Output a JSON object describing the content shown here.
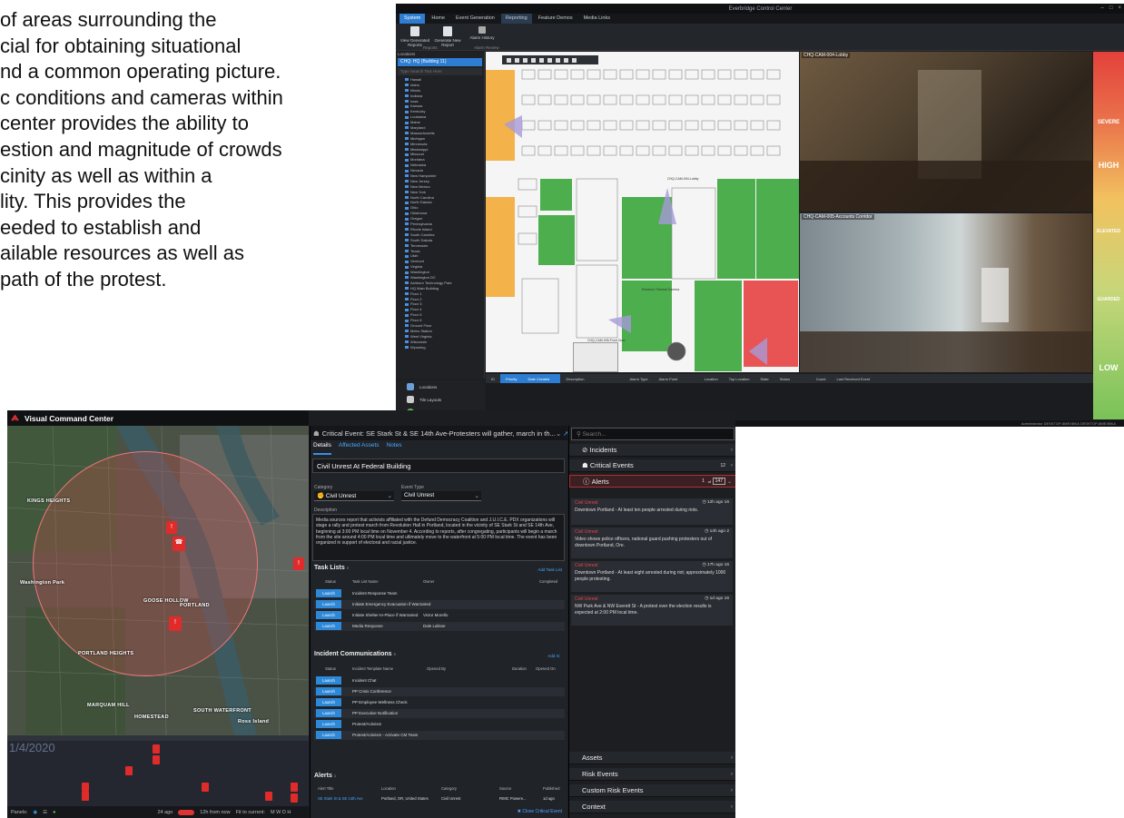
{
  "intro": {
    "lines": [
      "of areas surrounding the",
      "cial for obtaining situational",
      "nd a common operating picture.",
      "c conditions and cameras within",
      "center provides the ability to",
      "estion and magnitude of crowds",
      "cinity as well as within a",
      "lity. This provides the",
      "eeded to establish and",
      "ailable resources as well as",
      "path of the protest."
    ]
  },
  "ecc": {
    "window_title": "Everbridge Control Center",
    "menu_tabs": [
      "System",
      "Home",
      "Event Generation",
      "Reporting",
      "Feature Demos",
      "Media Links"
    ],
    "active_menu": "Reporting",
    "ribbon": {
      "buttons": [
        "View Generated Reports",
        "Generate New Report",
        "Alarm History"
      ],
      "group_labels": [
        "Reports",
        "Alarm Review"
      ]
    },
    "sidebar": {
      "header": "Locations",
      "selected_location": "CHQ: HQ (Building 11)",
      "search_placeholder": "Type Search Text Here",
      "tree_items": [
        "Hawaii",
        "Idaho",
        "Illinois",
        "Indiana",
        "Iowa",
        "Kansas",
        "Kentucky",
        "Louisiana",
        "Maine",
        "Maryland",
        "Massachusetts",
        "Michigan",
        "Minnesota",
        "Mississippi",
        "Missouri",
        "Montana",
        "Nebraska",
        "Nevada",
        "New Hampshire",
        "New Jersey",
        "New Mexico",
        "New York",
        "North Carolina",
        "North Dakota",
        "Ohio",
        "Oklahoma",
        "Oregon",
        "Pennsylvania",
        "Rhode Island",
        "South Carolina",
        "South Dakota",
        "Tennessee",
        "Texas",
        "Utah",
        "Vermont",
        "Virginia",
        "Washington",
        "Washington DC",
        "Ashburn Technology Park",
        "HQ Main Building",
        "Floor 1",
        "Floor 2",
        "Floor 3",
        "Floor 4",
        "Floor 5",
        "Floor 6",
        "Ground Floor",
        "Metro Station",
        "West Virginia",
        "Wisconsin",
        "Wyoming"
      ],
      "nav_buttons": [
        "Locations",
        "Tile Layouts",
        "Sequences"
      ]
    },
    "floor": {
      "labels": [
        "CHQ-CAM-004-Lobby",
        "Entrance Thermal Camera",
        "CHQ-CAM-005-Front Door",
        "CHQ-CAM-006"
      ]
    },
    "cameras": [
      {
        "title": "CHQ-CAM-004-Lobby"
      },
      {
        "title": "CHQ-CAM-005-Accounts Corridor"
      }
    ],
    "threat_levels": [
      "SEVERE",
      "HIGH",
      "ELEVATED",
      "GUARDED",
      "LOW"
    ],
    "alarm_columns": [
      "ID",
      "Priority",
      "Date Created",
      "Description",
      "Alarm Type",
      "Alarm Point",
      "Location",
      "Top Location",
      "State",
      "Status",
      "Count",
      "Last Received Event"
    ],
    "status_left": "11/18/2020 8:00 PM   Welcome to VSecurityCenter",
    "status_right": "Administrator   DESKTOP-8MEXBKA   DESKTOP-8MEXBKA"
  },
  "vcc": {
    "app_title": "Visual Command Center",
    "map": {
      "labels": [
        "KINGS HEIGHTS",
        "GOOSE HOLLOW",
        "PORTLAND",
        "PORTLAND HEIGHTS",
        "SOUTH WATERFRONT",
        "MARQUAM HILL",
        "HOMESTEAD",
        "Ross Island",
        "Washington Park"
      ]
    },
    "timeline": {
      "date": "1/4/2020"
    },
    "panels_bar": {
      "label": "Panels:",
      "zoom": "24 ago",
      "right_text": "12h from now",
      "fit_label": "Fit to current:",
      "scales": "M  W  D  H"
    },
    "critical_event": {
      "header_prefix": "Critical Event:",
      "header_text": "SE Stark St & SE 14th Ave-Protesters will gather, march in th...",
      "tabs": [
        "Details",
        "Affected Assets",
        "Notes"
      ],
      "active_tab": "Details",
      "title": "Civil Unrest At Federal Building",
      "category_label": "Category",
      "category_value": "Civil Unrest",
      "event_type_label": "Event Type",
      "event_type_value": "Civil Unrest",
      "description_label": "Description",
      "description": "Media sources report that activists affiliated with the Defund Democracy Coalition and J.U.I.C.E. PDX organizations will stage a rally and protest march from Revolution Hall in Portland, located in the vicinity of SE Stark St and SE 14th Ave, beginning at 3:00 PM local time on November 4. According to reports, after congregating, participants will begin a march from the site around 4:00 PM local time and ultimately move to the waterfront at 5:00 PM local time. The event has been organized in support of  electoral and racial justice.",
      "task_lists": {
        "title": "Task Lists",
        "count": "4",
        "add_link": "Add Task List",
        "columns": [
          "Status",
          "Task List Name",
          "Owner",
          "Completed"
        ],
        "rows": [
          {
            "button": "Launch",
            "name": "Incident Response Team",
            "owner": ""
          },
          {
            "button": "Launch",
            "name": "Initiate Emergency Evacuation if Warranted",
            "owner": ""
          },
          {
            "button": "Launch",
            "name": "Initiate Shelter-In-Place if Warranted",
            "owner": "Victor Morello"
          },
          {
            "button": "Launch",
            "name": "Media Response",
            "owner": "Dale Lalisse"
          }
        ]
      },
      "communications": {
        "title": "Incident Communications",
        "count": "6",
        "add_link": "Add IC",
        "columns": [
          "Status",
          "Incident Template Name",
          "Opened By",
          "Duration",
          "Opened On"
        ],
        "rows": [
          {
            "button": "Launch",
            "name": "Incident Chat"
          },
          {
            "button": "Launch",
            "name": "PP Crisis Conference"
          },
          {
            "button": "Launch",
            "name": "PP Employee Wellness Check"
          },
          {
            "button": "Launch",
            "name": "PP Executive Notification"
          },
          {
            "button": "Launch",
            "name": "Protest/Activism"
          },
          {
            "button": "Launch",
            "name": "Protest/Activism - Activate CM Team"
          }
        ]
      },
      "alerts": {
        "title": "Alerts",
        "count": "1",
        "columns": [
          "Alert Title",
          "Location",
          "Category",
          "Source",
          "Published"
        ],
        "row": {
          "title": "SE Stark St & SE 14th Ave",
          "location": "Portland, OR, United States",
          "category": "Civil Unrest",
          "source": "RIMC Powere...",
          "published": "1d ago"
        }
      },
      "close_label": "Close Critical Event"
    },
    "right_panel": {
      "search_placeholder": "Search...",
      "incidents_label": "Incidents",
      "critical_events_label": "Critical Events",
      "critical_events_count": "12",
      "alerts_label": "Alerts",
      "alerts_page": "1",
      "alerts_of": "of",
      "alerts_total": "147",
      "alert_cards": [
        {
          "type": "Civil Unrest",
          "time": "12h ago",
          "count": "16",
          "text": "Downtown Portland - At least ten people arrested during riots."
        },
        {
          "type": "Civil Unrest",
          "time": "14h ago",
          "count": "2",
          "text": "Video shows police officers, national guard pushing protesters out of downtown Portland, Ore."
        },
        {
          "type": "Civil Unrest",
          "time": "17h ago",
          "count": "16",
          "text": "Downtown Portland - At least eight arrested during riot; approximately 1000 people protesting."
        },
        {
          "type": "Civil Unrest",
          "time": "1d ago",
          "count": "16",
          "text": "NW Park Ave & NW Everett St - A protest over the election results is expected at 2:00 PM local time."
        }
      ],
      "bottom_rows": [
        "Assets",
        "Risk Events",
        "Custom Risk Events",
        "Context"
      ]
    }
  }
}
